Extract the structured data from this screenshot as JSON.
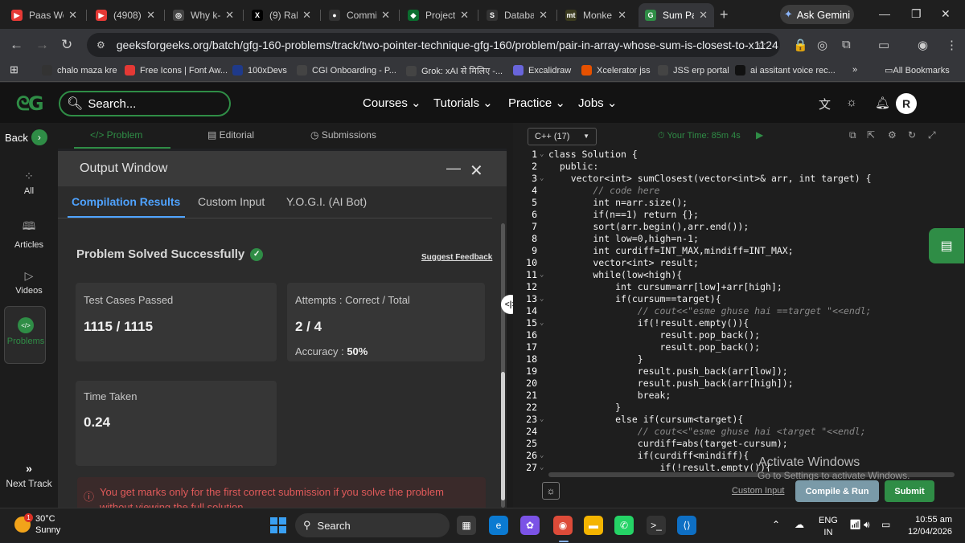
{
  "browser": {
    "tabs": [
      {
        "title": "Paas Wo",
        "fav_color": "#e53935",
        "fav_text": "▶"
      },
      {
        "title": "(4908) S",
        "fav_color": "#e53935",
        "fav_text": "▶"
      },
      {
        "title": "Why k-",
        "fav_color": "#444444",
        "fav_text": "◎"
      },
      {
        "title": "(9) Rahu",
        "fav_color": "#000000",
        "fav_text": "X"
      },
      {
        "title": "Commi",
        "fav_color": "#333333",
        "fav_text": "●"
      },
      {
        "title": "Project",
        "fav_color": "#0a6d2e",
        "fav_text": "◆"
      },
      {
        "title": "Databa",
        "fav_color": "#333333",
        "fav_text": "S"
      },
      {
        "title": "Monke",
        "fav_color": "#3b3b1f",
        "fav_text": "mt"
      },
      {
        "title": "Sum Pa",
        "fav_color": "#2f8d46",
        "fav_text": "G"
      }
    ],
    "new_tab": "+",
    "gemini_label": "Ask Gemini",
    "url": "geeksforgeeks.org/batch/gfg-160-problems/track/two-pointer-technique-gfg-160/problem/pair-in-array-whose-sum-is-closest-to-x1124"
  },
  "bookmarks": [
    {
      "label": "chalo maza kre",
      "color": "#333333"
    },
    {
      "label": "Free Icons | Font Aw...",
      "color": "#e53935"
    },
    {
      "label": "100xDevs",
      "color": "#1f3a8a"
    },
    {
      "label": "CGI Onboarding - P...",
      "color": "#444444"
    },
    {
      "label": "Grok: xAI से मिलिए -...",
      "color": "#444444"
    },
    {
      "label": "Excalidraw",
      "color": "#6965db"
    },
    {
      "label": "Xcelerator jss",
      "color": "#e65100"
    },
    {
      "label": "JSS erp portal",
      "color": "#444444"
    },
    {
      "label": "ai assitant voice rec...",
      "color": "#111111"
    }
  ],
  "all_bookmarks": "All Bookmarks",
  "gfg": {
    "search_placeholder": "Search...",
    "nav": [
      "Courses",
      "Tutorials",
      "Practice",
      "Jobs"
    ],
    "avatar_initial": "R"
  },
  "rail": {
    "back": "Back",
    "items": [
      "All",
      "Articles",
      "Videos",
      "Problems"
    ],
    "next_track": "Next Track"
  },
  "problem_tabs": [
    "</> Problem",
    "Editorial",
    "Submissions"
  ],
  "output": {
    "title": "Output Window",
    "tabs": [
      "Compilation Results",
      "Custom Input",
      "Y.O.G.I. (AI Bot)"
    ],
    "status": "Problem Solved Successfully",
    "feedback": "Suggest Feedback",
    "tests_label": "Test Cases Passed",
    "tests_value": "1115 / 1115",
    "attempts_label": "Attempts : Correct / Total",
    "attempts_value": "2 / 4",
    "accuracy_label": "Accuracy :",
    "accuracy_value": "50%",
    "time_label": "Time Taken",
    "time_value": "0.24",
    "notice": "You get marks only for the first correct submission if you solve the problem without viewing the full solution."
  },
  "editor": {
    "language": "C++ (17)",
    "timer": "Your Time: 85m 4s",
    "lines": [
      "class Solution {",
      "  public:",
      "    vector<int> sumClosest(vector<int>& arr, int target) {",
      "        // code here",
      "        int n=arr.size();",
      "        if(n==1) return {};",
      "        sort(arr.begin(),arr.end());",
      "        int low=0,high=n-1;",
      "        int curdiff=INT_MAX,mindiff=INT_MAX;",
      "        vector<int> result;",
      "        while(low<high){",
      "            int cursum=arr[low]+arr[high];",
      "            if(cursum==target){",
      "                // cout<<\"esme ghuse hai ==target \"<<endl;",
      "                if(!result.empty()){",
      "                    result.pop_back();",
      "                    result.pop_back();",
      "                }",
      "                result.push_back(arr[low]);",
      "                result.push_back(arr[high]);",
      "                break;",
      "            }",
      "            else if(cursum<target){",
      "                // cout<<\"esme ghuse hai <target \"<<endl;",
      "                curdiff=abs(target-cursum);",
      "                if(curdiff<mindiff){",
      "                    if(!result.empty()){"
    ],
    "fold_lines": [
      1,
      3,
      11,
      13,
      15,
      23,
      26,
      27
    ],
    "custom_input": "Custom Input",
    "compile": "Compile & Run",
    "submit": "Submit",
    "activate_title": "Activate Windows",
    "activate_sub": "Go to Settings to activate Windows."
  },
  "taskbar": {
    "temp": "30°C",
    "weather": "Sunny",
    "weather_badge": "1",
    "search": "Search",
    "lang1": "ENG",
    "lang2": "IN",
    "time": "10:55 am",
    "date": "12/04/2026"
  }
}
